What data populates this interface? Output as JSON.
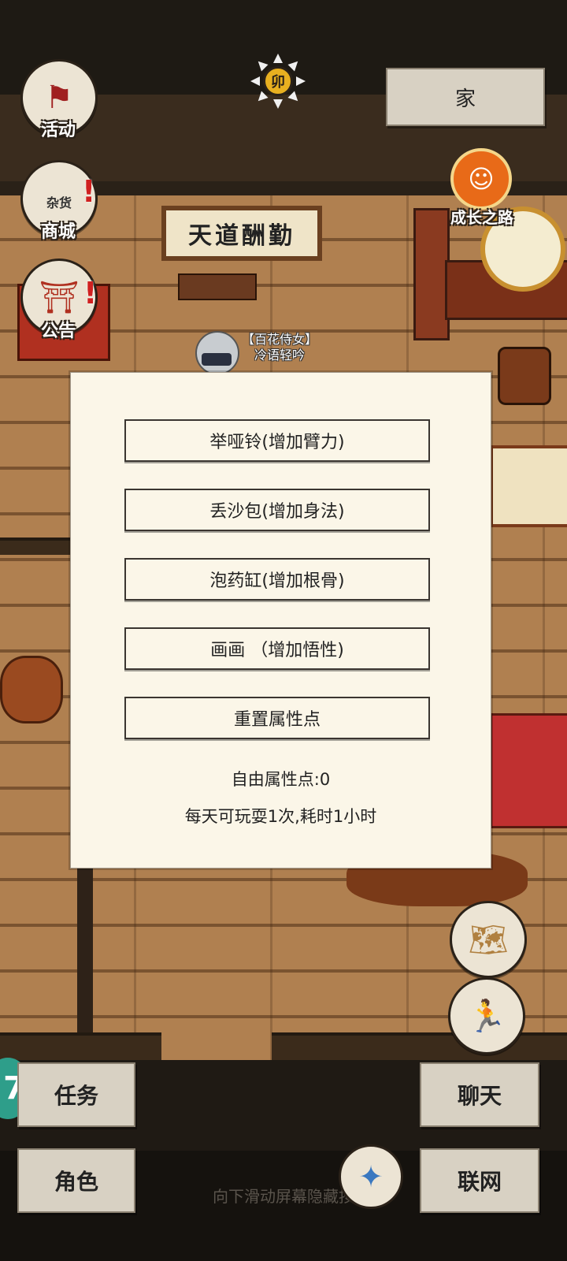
{
  "header": {
    "time_symbol": "卯",
    "location_button": "家"
  },
  "left_menu": [
    {
      "label": "活动",
      "icon": "banner-icon"
    },
    {
      "label": "商城",
      "icon": "shop-icon",
      "sign": "杂货",
      "alert": true
    },
    {
      "label": "公告",
      "icon": "notice-icon",
      "alert": true
    }
  ],
  "right_menu": {
    "growth_label": "成长之路"
  },
  "scene": {
    "plaque_text": "天道酬勤",
    "npc_title": "【百花侍女】",
    "npc_name": "冷语轻吟"
  },
  "dialog": {
    "options": [
      "举哑铃(增加臂力)",
      "丢沙包(增加身法)",
      "泡药缸(增加根骨)",
      "画画 （增加悟性)",
      "重置属性点"
    ],
    "free_points": "自由属性点:0",
    "note": "每天可玩耍1次,耗时1小时"
  },
  "bottom": {
    "task_button": "任务",
    "chat_button": "聊天",
    "role_button": "角色",
    "network_button": "联网",
    "hint_text": "向下滑动屏幕隐藏按",
    "edge_badge": "7"
  },
  "colors": {
    "paper": "#fbf6e8",
    "button": "#d8d1c3",
    "wood": "#b08050",
    "accent_red": "#d02020"
  }
}
